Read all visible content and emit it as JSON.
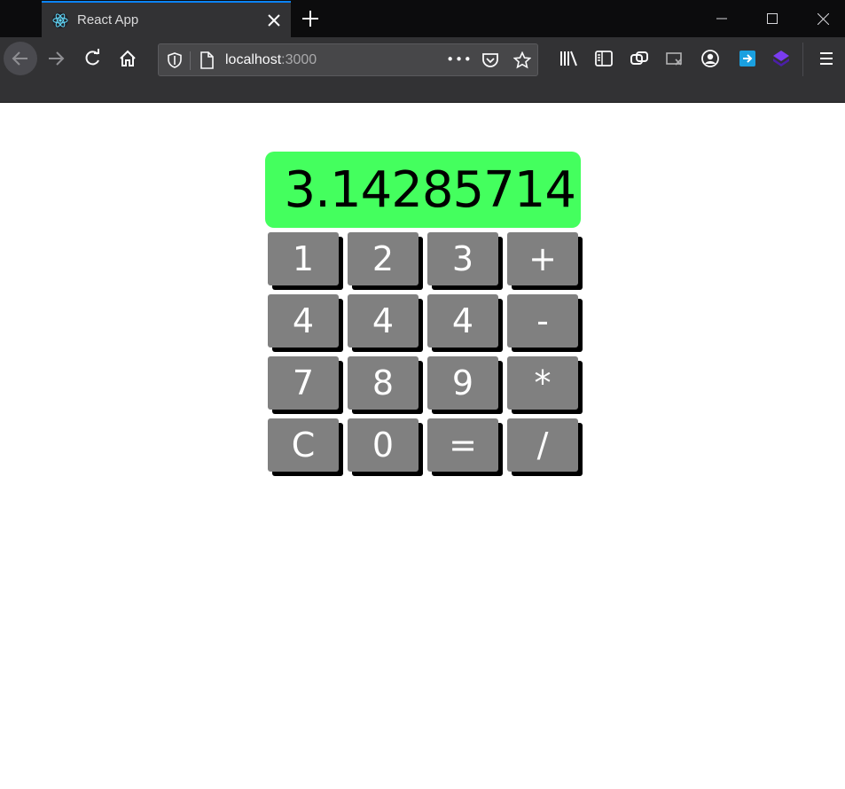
{
  "browser": {
    "tab_title": "React App",
    "url_host": "localhost",
    "url_port": ":3000",
    "url_actions_label": "•••",
    "icons": [
      "react-logo-icon",
      "close-tab-icon",
      "new-tab-icon",
      "minimize-icon",
      "maximize-icon",
      "window-close-icon",
      "back-icon",
      "forward-icon",
      "reload-icon",
      "home-icon",
      "tracking-shield-icon",
      "page-icon",
      "page-actions-icon",
      "pocket-icon",
      "bookmark-star-icon",
      "library-icon",
      "sidebar-icon",
      "extension-link-icon",
      "extension-screenshot-icon",
      "account-icon",
      "extension-arrow-icon",
      "extension-cube-icon",
      "menu-icon"
    ]
  },
  "colors": {
    "display_bg": "#44ff5e",
    "key_bg": "#808080",
    "key_shadow": "#000000",
    "accent": "#0a84ff"
  },
  "calculator": {
    "display": "3.14285714",
    "keys": [
      [
        "1",
        "2",
        "3",
        "+"
      ],
      [
        "4",
        "4",
        "4",
        "-"
      ],
      [
        "7",
        "8",
        "9",
        "*"
      ],
      [
        "C",
        "0",
        "=",
        "/"
      ]
    ]
  }
}
